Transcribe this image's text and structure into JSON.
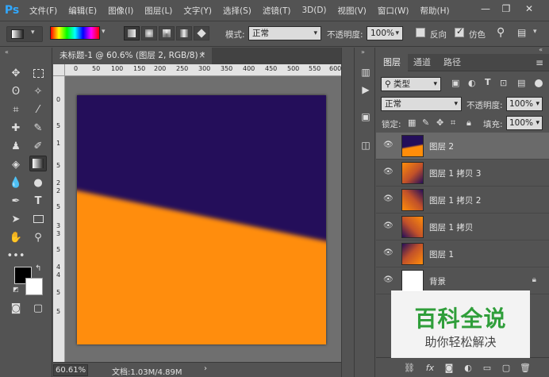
{
  "app": {
    "logo": "Ps"
  },
  "menu": [
    "文件(F)",
    "编辑(E)",
    "图像(I)",
    "图层(L)",
    "文字(Y)",
    "选择(S)",
    "滤镜(T)",
    "3D(D)",
    "视图(V)",
    "窗口(W)",
    "帮助(H)"
  ],
  "window_controls": {
    "minimize": "—",
    "restore": "❐",
    "close": "✕"
  },
  "options": {
    "mode_label": "模式:",
    "mode_value": "正常",
    "opacity_label": "不透明度:",
    "opacity_value": "100%",
    "reverse_label": "反向",
    "reverse_checked": false,
    "dither_label": "仿色",
    "dither_checked": true
  },
  "document": {
    "tab_title": "未标题-1 @ 60.6% (图层 2, RGB/8) *",
    "close": "×",
    "zoom": "60.61%",
    "doc_info": "文档:1.03M/4.89M",
    "ruler_h": [
      "0",
      "50",
      "100",
      "150",
      "200",
      "250",
      "300",
      "350",
      "400",
      "450",
      "500",
      "550",
      "600"
    ],
    "ruler_v": [
      "0",
      "5",
      "1",
      "5",
      "2",
      "2",
      "5",
      "3",
      "3",
      "5",
      "4",
      "4",
      "5",
      "5"
    ],
    "colors": {
      "purple": "#240e5a",
      "orange": "#ff8d0a"
    }
  },
  "layers_panel": {
    "tabs": [
      "图层",
      "通道",
      "路径"
    ],
    "filter_label": "类型",
    "blend_mode": "正常",
    "opacity_label": "不透明度:",
    "opacity_value": "100%",
    "lock_label": "锁定:",
    "fill_label": "填充:",
    "fill_value": "100%",
    "layers": [
      {
        "name": "图层 2",
        "selected": true
      },
      {
        "name": "图层 1 拷贝 3",
        "selected": false
      },
      {
        "name": "图层 1 拷贝 2",
        "selected": false
      },
      {
        "name": "图层 1 拷贝",
        "selected": false
      },
      {
        "name": "图层 1",
        "selected": false
      },
      {
        "name": "背景",
        "selected": false,
        "locked": true
      }
    ]
  },
  "watermark": {
    "title": "百科全说",
    "subtitle": "助你轻松解决"
  }
}
